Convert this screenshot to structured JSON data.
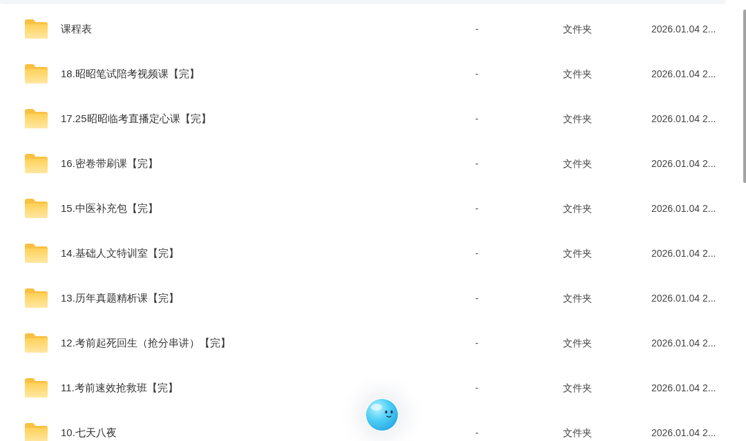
{
  "files": [
    {
      "name": "课程表",
      "size": "-",
      "type": "文件夹",
      "modified": "2026.01.04 2..."
    },
    {
      "name": "18.昭昭笔试陪考视频课【完】",
      "size": "-",
      "type": "文件夹",
      "modified": "2026.01.04 2..."
    },
    {
      "name": "17.25昭昭临考直播定心课【完】",
      "size": "-",
      "type": "文件夹",
      "modified": "2026.01.04 2..."
    },
    {
      "name": "16.密卷带刷课【完】",
      "size": "-",
      "type": "文件夹",
      "modified": "2026.01.04 2..."
    },
    {
      "name": "15.中医补充包【完】",
      "size": "-",
      "type": "文件夹",
      "modified": "2026.01.04 2..."
    },
    {
      "name": "14.基础人文特训室【完】",
      "size": "-",
      "type": "文件夹",
      "modified": "2026.01.04 2..."
    },
    {
      "name": "13.历年真题精析课【完】",
      "size": "-",
      "type": "文件夹",
      "modified": "2026.01.04 2..."
    },
    {
      "name": "12.考前起死回生（抢分串讲）【完】",
      "size": "-",
      "type": "文件夹",
      "modified": "2026.01.04 2..."
    },
    {
      "name": "11.考前速效抢救班【完】",
      "size": "-",
      "type": "文件夹",
      "modified": "2026.01.04 2..."
    },
    {
      "name": "10.七天八夜",
      "size": "-",
      "type": "文件夹",
      "modified": "2026.01.04 2..."
    }
  ]
}
